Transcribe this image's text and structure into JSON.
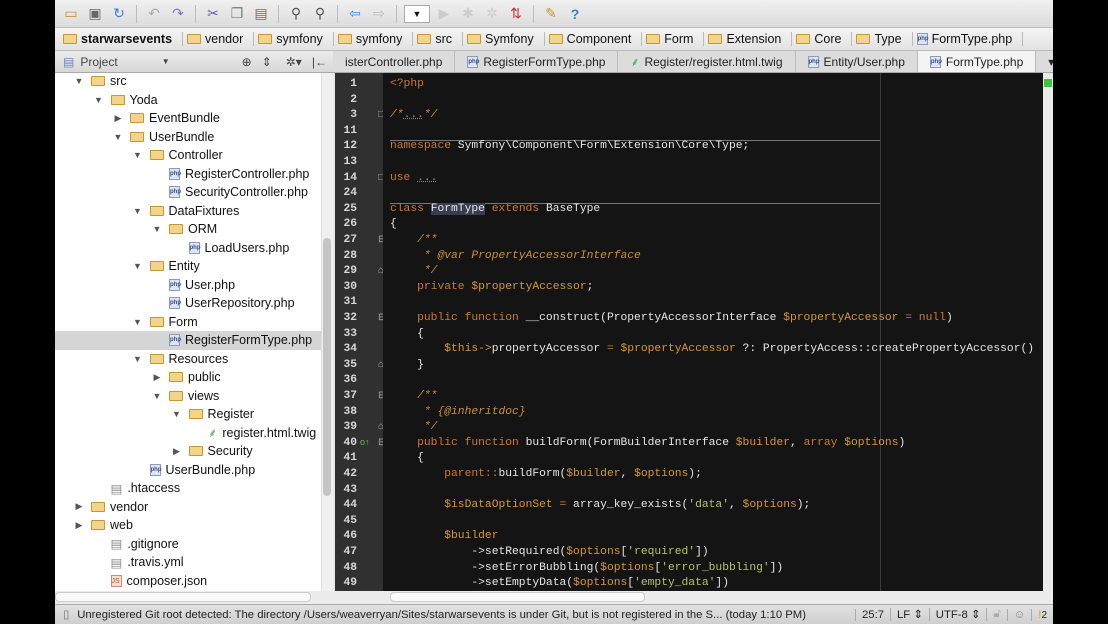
{
  "toolbar": {
    "icons": [
      "open-folder-icon",
      "save-icon",
      "sync-icon",
      "undo-icon",
      "redo-icon",
      "cut-icon",
      "copy-icon",
      "paste-icon",
      "find-icon",
      "replace-icon",
      "back-icon",
      "forward-icon",
      "run-config-dropdown",
      "run-icon",
      "debug-icon",
      "coverage-icon",
      "vcs-icon",
      "settings-icon",
      "help-icon"
    ]
  },
  "breadcrumbs": [
    "starwarsevents",
    "vendor",
    "symfony",
    "symfony",
    "src",
    "Symfony",
    "Component",
    "Form",
    "Extension",
    "Core",
    "Type",
    "FormType.php"
  ],
  "project_panel": {
    "label": "Project"
  },
  "tabs": [
    {
      "label": "isterController.php",
      "icon": "php"
    },
    {
      "label": "RegisterFormType.php",
      "icon": "php"
    },
    {
      "label": "Register/register.html.twig",
      "icon": "twig"
    },
    {
      "label": "Entity/User.php",
      "icon": "php"
    },
    {
      "label": "FormType.php",
      "icon": "php",
      "active": true
    }
  ],
  "tree": [
    {
      "label": "src",
      "level": 0,
      "type": "folder",
      "open": true
    },
    {
      "label": "Yoda",
      "level": 1,
      "type": "folder",
      "open": true
    },
    {
      "label": "EventBundle",
      "level": 2,
      "type": "folder",
      "open": false
    },
    {
      "label": "UserBundle",
      "level": 2,
      "type": "folder",
      "open": true
    },
    {
      "label": "Controller",
      "level": 3,
      "type": "folder",
      "open": true
    },
    {
      "label": "RegisterController.php",
      "level": 4,
      "type": "php"
    },
    {
      "label": "SecurityController.php",
      "level": 4,
      "type": "php"
    },
    {
      "label": "DataFixtures",
      "level": 3,
      "type": "folder",
      "open": true
    },
    {
      "label": "ORM",
      "level": 4,
      "type": "folder",
      "open": true
    },
    {
      "label": "LoadUsers.php",
      "level": 5,
      "type": "php"
    },
    {
      "label": "Entity",
      "level": 3,
      "type": "folder",
      "open": true
    },
    {
      "label": "User.php",
      "level": 4,
      "type": "php"
    },
    {
      "label": "UserRepository.php",
      "level": 4,
      "type": "php"
    },
    {
      "label": "Form",
      "level": 3,
      "type": "folder",
      "open": true
    },
    {
      "label": "RegisterFormType.php",
      "level": 4,
      "type": "php",
      "selected": true
    },
    {
      "label": "Resources",
      "level": 3,
      "type": "folder",
      "open": true
    },
    {
      "label": "public",
      "level": 4,
      "type": "folder",
      "open": false
    },
    {
      "label": "views",
      "level": 4,
      "type": "folder",
      "open": true
    },
    {
      "label": "Register",
      "level": 5,
      "type": "folder",
      "open": true
    },
    {
      "label": "register.html.twig",
      "level": 6,
      "type": "twig"
    },
    {
      "label": "Security",
      "level": 5,
      "type": "folder",
      "open": false
    },
    {
      "label": "UserBundle.php",
      "level": 3,
      "type": "php"
    },
    {
      "label": ".htaccess",
      "level": 1,
      "type": "file"
    },
    {
      "label": "vendor",
      "level": 0,
      "type": "folder",
      "open": false
    },
    {
      "label": "web",
      "level": 0,
      "type": "folder",
      "open": false
    },
    {
      "label": ".gitignore",
      "level": 1,
      "type": "file"
    },
    {
      "label": ".travis.yml",
      "level": 1,
      "type": "file"
    },
    {
      "label": "composer.json",
      "level": 1,
      "type": "json"
    }
  ],
  "code": [
    {
      "n": "1",
      "t": [
        [
          "kw",
          "<?php"
        ]
      ]
    },
    {
      "n": "2",
      "t": []
    },
    {
      "n": "3",
      "t": [
        [
          "doc",
          "/*"
        ],
        [
          "fold",
          "..."
        ],
        [
          "doc",
          "*/"
        ]
      ],
      "rule_after": true
    },
    {
      "n": "11",
      "t": []
    },
    {
      "n": "12",
      "t": [
        [
          "kw",
          "namespace "
        ],
        [
          "",
          "Symfony\\Component\\Form\\Extension\\Core\\Type;"
        ]
      ]
    },
    {
      "n": "13",
      "t": []
    },
    {
      "n": "14",
      "t": [
        [
          "kw",
          "use "
        ],
        [
          "fold",
          "..."
        ]
      ],
      "rule_after": true
    },
    {
      "n": "24",
      "t": []
    },
    {
      "n": "25",
      "t": [
        [
          "kw",
          "class "
        ],
        [
          "hl",
          "FormType"
        ],
        [
          "kw",
          " extends "
        ],
        [
          "",
          "BaseType"
        ]
      ]
    },
    {
      "n": "26",
      "t": [
        [
          "",
          "{"
        ]
      ]
    },
    {
      "n": "27",
      "t": [
        [
          "doc",
          "    /**"
        ]
      ]
    },
    {
      "n": "28",
      "t": [
        [
          "doc",
          "     * @var PropertyAccessorInterface"
        ]
      ]
    },
    {
      "n": "29",
      "t": [
        [
          "doc",
          "     */"
        ]
      ]
    },
    {
      "n": "30",
      "t": [
        [
          "kw",
          "    private "
        ],
        [
          "var",
          "$propertyAccessor"
        ],
        [
          "",
          ";"
        ]
      ]
    },
    {
      "n": "31",
      "t": []
    },
    {
      "n": "32",
      "t": [
        [
          "kw",
          "    public function "
        ],
        [
          "",
          "__construct(PropertyAccessorInterface "
        ],
        [
          "var",
          "$propertyAccessor"
        ],
        [
          "kw",
          " = null"
        ],
        [
          "",
          ")"
        ]
      ]
    },
    {
      "n": "33",
      "t": [
        [
          "",
          "    {"
        ]
      ]
    },
    {
      "n": "34",
      "t": [
        [
          "var",
          "        $this->"
        ],
        [
          "",
          "propertyAccessor "
        ],
        [
          "kw",
          "= "
        ],
        [
          "var",
          "$propertyAccessor"
        ],
        [
          "",
          " ?: PropertyAccess::createPropertyAccessor()"
        ]
      ]
    },
    {
      "n": "35",
      "t": [
        [
          "",
          "    }"
        ]
      ]
    },
    {
      "n": "36",
      "t": []
    },
    {
      "n": "37",
      "t": [
        [
          "doc",
          "    /**"
        ]
      ]
    },
    {
      "n": "38",
      "t": [
        [
          "doc",
          "     * {@inheritdoc}"
        ]
      ]
    },
    {
      "n": "39",
      "t": [
        [
          "doc",
          "     */"
        ]
      ]
    },
    {
      "n": "40",
      "t": [
        [
          "kw",
          "    public function "
        ],
        [
          "",
          "buildForm(FormBuilderInterface "
        ],
        [
          "var",
          "$builder"
        ],
        [
          "",
          ", "
        ],
        [
          "kw",
          "array "
        ],
        [
          "var",
          "$options"
        ],
        [
          "",
          ")"
        ]
      ]
    },
    {
      "n": "41",
      "t": [
        [
          "",
          "    {"
        ]
      ]
    },
    {
      "n": "42",
      "t": [
        [
          "kw",
          "        parent::"
        ],
        [
          "",
          "buildForm("
        ],
        [
          "var",
          "$builder"
        ],
        [
          "",
          ", "
        ],
        [
          "var",
          "$options"
        ],
        [
          "",
          ");"
        ]
      ]
    },
    {
      "n": "43",
      "t": []
    },
    {
      "n": "44",
      "t": [
        [
          "var",
          "        $isDataOptionSet"
        ],
        [
          "kw",
          " = "
        ],
        [
          "",
          "array_key_exists("
        ],
        [
          "str",
          "'data'"
        ],
        [
          "",
          ", "
        ],
        [
          "var",
          "$options"
        ],
        [
          "",
          ");"
        ]
      ]
    },
    {
      "n": "45",
      "t": []
    },
    {
      "n": "46",
      "t": [
        [
          "var",
          "        $builder"
        ]
      ]
    },
    {
      "n": "47",
      "t": [
        [
          "",
          "            ->setRequired("
        ],
        [
          "var",
          "$options"
        ],
        [
          "",
          "["
        ],
        [
          "str",
          "'required'"
        ],
        [
          "",
          "])"
        ]
      ]
    },
    {
      "n": "48",
      "t": [
        [
          "",
          "            ->setErrorBubbling("
        ],
        [
          "var",
          "$options"
        ],
        [
          "",
          "["
        ],
        [
          "str",
          "'error_bubbling'"
        ],
        [
          "",
          "])"
        ]
      ]
    },
    {
      "n": "49",
      "t": [
        [
          "",
          "            ->setEmptyData("
        ],
        [
          "var",
          "$options"
        ],
        [
          "",
          "["
        ],
        [
          "str",
          "'empty_data'"
        ],
        [
          "",
          "])"
        ]
      ]
    }
  ],
  "status": {
    "message": "Unregistered Git root detected: The directory /Users/weaverryan/Sites/starwarsevents is under Git, but is not registered in the S... (today 1:10 PM)",
    "position": "25:7",
    "line_ending": "LF",
    "encoding": "UTF-8",
    "notifications": "2"
  },
  "colors": {
    "keyword": "#cc7832",
    "variable": "#d6963c",
    "string": "#b5c46c",
    "editor_bg": "#141414"
  }
}
